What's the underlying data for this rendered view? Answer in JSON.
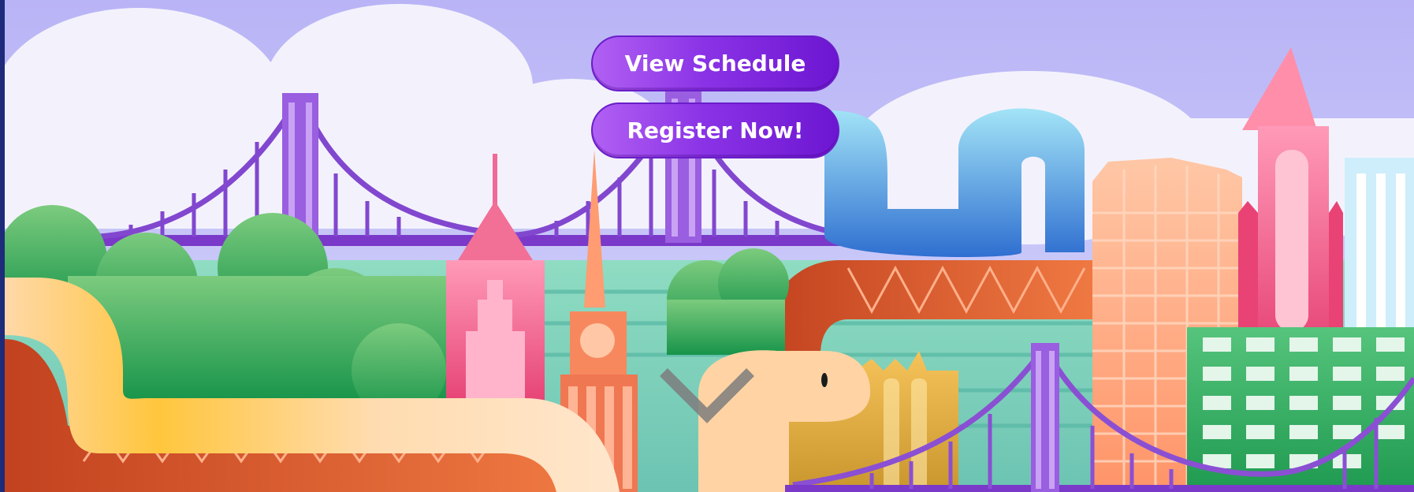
{
  "hero": {
    "buttons": {
      "view_schedule": "View Schedule",
      "register_now": "Register Now!"
    },
    "scroll_indicator_icon": "chevron-down-icon"
  },
  "colors": {
    "sky": "#b6b2f5",
    "cloud": "#f2f1fb",
    "button_purple": "#7a22dc",
    "bridge_purple": "#8a4fd3",
    "bridge_orange": "#d5582f",
    "water_teal": "#7fcdb8",
    "tree_green": "#3aa455",
    "building_pink": "#f06a98",
    "building_peach": "#ffb892",
    "building_green": "#3fb56a",
    "snake_blue": "#5aa8e6"
  }
}
